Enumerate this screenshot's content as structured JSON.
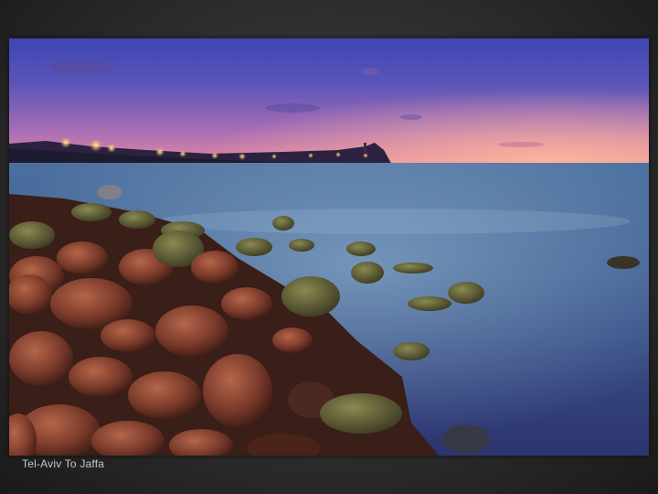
{
  "caption": "Tel-Aviv To Jaffa",
  "photo": {
    "subject": "coastline-at-dusk-photo"
  }
}
